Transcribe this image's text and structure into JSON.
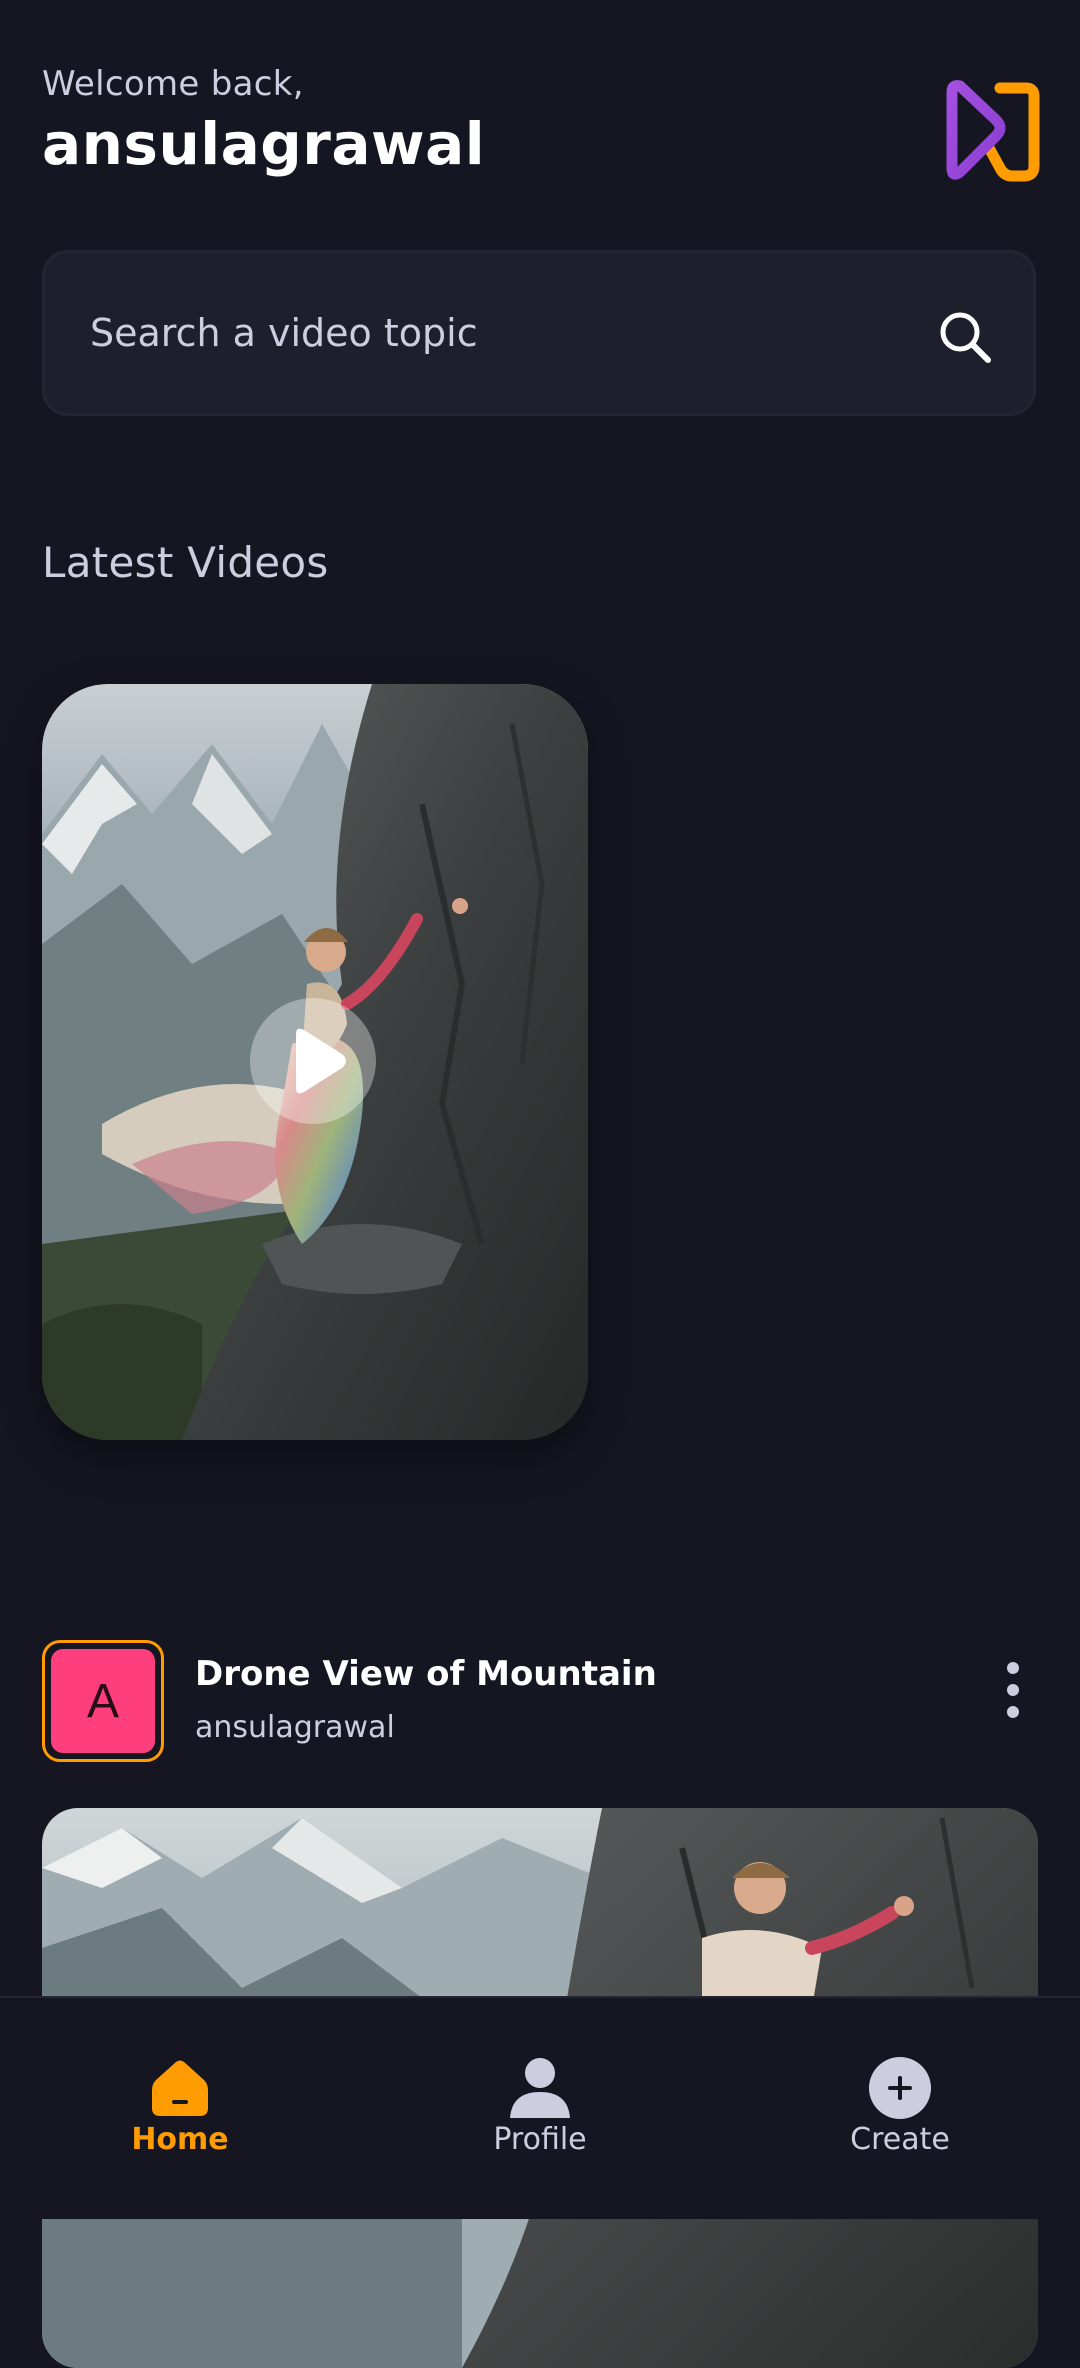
{
  "header": {
    "greeting": "Welcome back,",
    "username": "ansulagrawal",
    "logo_icon": "app-logo-icon"
  },
  "search": {
    "placeholder": "Search a video topic",
    "value": "",
    "icon": "search-icon"
  },
  "latest": {
    "title": "Latest Videos",
    "play_icon": "play-icon"
  },
  "video": {
    "avatar_letter": "A",
    "title": "Drone View of Mountain",
    "creator": "ansulagrawal",
    "menu_icon": "more-vertical-icon"
  },
  "tabs": [
    {
      "label": "Home",
      "icon": "home-icon",
      "active": true
    },
    {
      "label": "Profile",
      "icon": "profile-icon",
      "active": false
    },
    {
      "label": "Create",
      "icon": "plus-icon",
      "active": false
    }
  ],
  "colors": {
    "background": "#161622",
    "accent": "#ff9c01",
    "avatar": "#ff3e7e",
    "muted_text": "#cdcde0",
    "search_bg": "#1e1e2d"
  }
}
